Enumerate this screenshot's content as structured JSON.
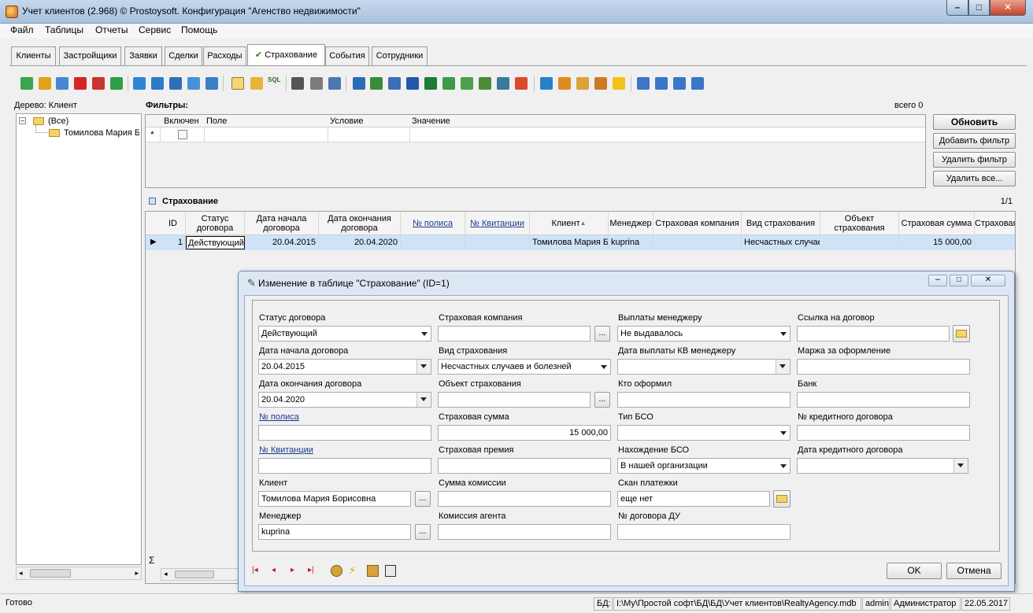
{
  "window": {
    "title": "Учет клиентов (2.968) © Prostoysoft. Конфигурация \"Агенство недвижимости\"",
    "min": "–",
    "max": "□",
    "close": "✕"
  },
  "menu": [
    "Файл",
    "Таблицы",
    "Отчеты",
    "Сервис",
    "Помощь"
  ],
  "tabs": [
    "Клиенты",
    "Застройщики",
    "Заявки",
    "Сделки",
    "Расходы",
    "Страхование",
    "События",
    "Сотрудники"
  ],
  "active_tab_index": 5,
  "tab_check": "✔",
  "toolbar_sql": "SQL",
  "tree": {
    "label": "Дерево: Клиент",
    "expander": "–",
    "root": "(Все)",
    "child": "Томилова Мария Б"
  },
  "filters": {
    "title": "Фильтры:",
    "count": "всего 0",
    "columns": [
      "Включен",
      "Поле",
      "Условие",
      "Значение"
    ],
    "new_row_marker": "*"
  },
  "filter_buttons": [
    "Обновить",
    "Добавить фильтр",
    "Удалить фильтр",
    "Удалить все..."
  ],
  "grid": {
    "title": "Страхование",
    "pager": "1/1",
    "columns": [
      "ID",
      "Статус договора",
      "Дата начала договора",
      "Дата окончания договора",
      "№ полиса",
      "№ Квитанции",
      "Клиент",
      "Менеджер",
      "Страховая компания",
      "Вид страхования",
      "Объект страхования",
      "Страховая сумма",
      "Страховая"
    ],
    "sort_glyph": "▲",
    "row": [
      "1",
      "Действующий",
      "20.04.2015",
      "20.04.2020",
      "",
      "",
      "Томилова Мария Б",
      "kuprina",
      "",
      "Несчастных случае",
      "",
      "15 000,00",
      ""
    ],
    "sum_glyph": "Σ",
    "row_marker": "▶"
  },
  "dialog": {
    "title": "Изменение в таблице \"Страхование\" (ID=1)",
    "ok": "OK",
    "cancel": "Отмена",
    "fields": {
      "status_label": "Статус договора",
      "status_value": "Действующий",
      "start_label": "Дата начала договора",
      "start_value": "20.04.2015",
      "end_label": "Дата окончания договора",
      "end_value": "20.04.2020",
      "policy_label": "№ полиса",
      "policy_value": "",
      "receipt_label": "№ Квитанции",
      "receipt_value": "",
      "client_label": "Клиент",
      "client_value": "Томилова Мария Борисовна",
      "manager_label": "Менеджер",
      "manager_value": "kuprina",
      "company_label": "Страховая компания",
      "company_value": "",
      "type_label": "Вид страхования",
      "type_value": "Несчастных случаев и болезней",
      "object_label": "Объект страхования",
      "object_value": "",
      "sum_label": "Страховая сумма",
      "sum_value": "15 000,00",
      "premium_label": "Страховая премия",
      "premium_value": "",
      "commission_label": "Сумма комиссии",
      "commission_value": "",
      "agent_label": "Комиссия агента",
      "agent_value": "",
      "payouts_label": "Выплаты менеджеру",
      "payouts_value": "Не выдавалось",
      "kv_date_label": "Дата выплаты КВ менеджеру",
      "kv_date_value": "",
      "issuer_label": "Кто оформил",
      "issuer_value": "",
      "bso_type_label": "Тип БСО",
      "bso_type_value": "",
      "bso_loc_label": "Нахождение БСО",
      "bso_loc_value": "В нашей организации",
      "scan_label": "Скан платежки",
      "scan_value": "еще нет",
      "du_label": "№ договора ДУ",
      "du_value": "",
      "link_label": "Ссылка на договор",
      "link_value": "",
      "margin_label": "Маржа за оформление",
      "margin_value": "",
      "bank_label": "Банк",
      "bank_value": "",
      "credit_no_label": "№ кредитного договора",
      "credit_no_value": "",
      "credit_date_label": "Дата кредитного договора",
      "credit_date_value": ""
    },
    "ellipsis": "..."
  },
  "status": {
    "ready": "Готово",
    "db_label": "БД:",
    "db_path": "I:\\My\\Простой софт\\БД\\БД\\Учет клиентов\\RealtyAgency.mdb",
    "user": "admin",
    "role": "Администратор",
    "date": "22.05.2017"
  }
}
